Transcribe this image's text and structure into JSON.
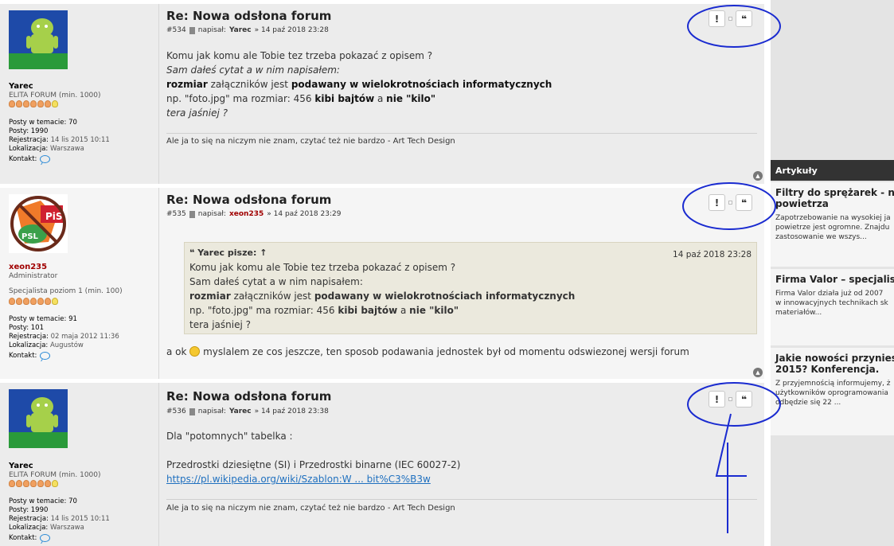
{
  "posts": [
    {
      "title": "Re: Nowa odsłona forum",
      "number": "#534",
      "written_by": "napisał:",
      "author": "Yarec",
      "date": "» 14 paź 2018 23:28",
      "user": {
        "name": "Yarec",
        "rank": "ELITA FORUM (min. 1000)",
        "posts_in_topic_label": "Posty w temacie:",
        "posts_in_topic": "70",
        "posts_label": "Posty:",
        "posts": "1990",
        "registered_label": "Rejestracja:",
        "registered": "14 lis 2015 10:11",
        "location_label": "Lokalizacja:",
        "location": "Warszawa",
        "contact_label": "Kontakt:"
      },
      "lines": {
        "l1": "Komu jak komu ale Tobie tez trzeba pokazać z opisem ?",
        "l2": "Sam dałeś cytat a w nim napisałem:",
        "l3a": "rozmiar",
        "l3b": " załączników jest ",
        "l3c": "podawany w wielokrotnościach informatycznych",
        "l4a": "np. \"foto.jpg\" ma rozmiar: 456 ",
        "l4b": "kibi bajtów",
        "l4c": " a ",
        "l4d": "nie \"kilo\"",
        "l5": "tera jaśniej ?"
      },
      "signature": "Ale ja to się na niczym nie znam, czytać też nie bardzo - Art Tech Design"
    },
    {
      "title": "Re: Nowa odsłona forum",
      "number": "#535",
      "written_by": "napisał:",
      "author": "xeon235",
      "date": "» 14 paź 2018 23:29",
      "user": {
        "name": "xeon235",
        "role": "Administrator",
        "rank": "Specjalista poziom 1 (min. 100)",
        "posts_in_topic_label": "Posty w temacie:",
        "posts_in_topic": "91",
        "posts_label": "Posty:",
        "posts": "101",
        "registered_label": "Rejestracja:",
        "registered": "02 maja 2012 11:36",
        "location_label": "Lokalizacja:",
        "location": "Augustów",
        "contact_label": "Kontakt:"
      },
      "quote": {
        "header": "Yarec pisze: ↑",
        "date": "14 paź 2018 23:28",
        "l1": "Komu jak komu ale Tobie tez trzeba pokazać z opisem ?",
        "l2": "Sam dałeś cytat a w nim napisałem:",
        "l3a": "rozmiar",
        "l3b": " załączników jest ",
        "l3c": "podawany w wielokrotnościach informatycznych",
        "l4a": "np. \"foto.jpg\" ma rozmiar: 456 ",
        "l4b": "kibi bajtów",
        "l4c": " a ",
        "l4d": "nie \"kilo\"",
        "l5": "tera jaśniej ?"
      },
      "reply_a": "a ok ",
      "reply_b": " myslalem ze cos jeszcze, ten sposob podawania jednostek był od momentu odswiezonej wersji forum"
    },
    {
      "title": "Re: Nowa odsłona forum",
      "number": "#536",
      "written_by": "napisał:",
      "author": "Yarec",
      "date": "» 14 paź 2018 23:38",
      "user": {
        "name": "Yarec",
        "rank": "ELITA FORUM (min. 1000)",
        "posts_in_topic_label": "Posty w temacie:",
        "posts_in_topic": "70",
        "posts_label": "Posty:",
        "posts": "1990",
        "registered_label": "Rejestracja:",
        "registered": "14 lis 2015 10:11",
        "location_label": "Lokalizacja:",
        "location": "Warszawa",
        "contact_label": "Kontakt:"
      },
      "lines": {
        "l1": "Dla \"potomnych\" tabelka :",
        "l2": "Przedrostki dziesiętne (SI) i Przedrostki binarne (IEC 60027-2)",
        "link": "https://pl.wikipedia.org/wiki/Szablon:W ... bit%C3%B3w"
      },
      "signature": "Ale ja to się na niczym nie znam, czytać też nie bardzo - Art Tech Design"
    }
  ],
  "buttons": {
    "report": "!",
    "quote": "❝"
  },
  "sidebar": {
    "header": "Artykuły",
    "items": [
      {
        "title_1": "Filtry do sprężarek - najle",
        "title_2": "powietrza",
        "text_1": "Zapotrzebowanie na wysokiej ja",
        "text_2": "powietrze jest ogromne. Znajdu",
        "text_3": "zastosowanie we wszys..."
      },
      {
        "title_1": "Firma Valor – specjalisty",
        "text_1": "Firma Valor działa już od 2007",
        "text_2": "w innowacyjnych technikach sk",
        "text_3": "materiałów..."
      },
      {
        "title_1": "Jakie nowości przyniesie",
        "title_2": "2015? Konferencja.",
        "text_1": "Z przyjemnością informujemy, ż",
        "text_2": "użytkowników oprogramowania",
        "text_3": "odbędzie się 22 ..."
      }
    ]
  },
  "colors": {
    "annotation": "#1a2bd0",
    "link": "#1f70bf",
    "admin_name": "#a00000"
  }
}
